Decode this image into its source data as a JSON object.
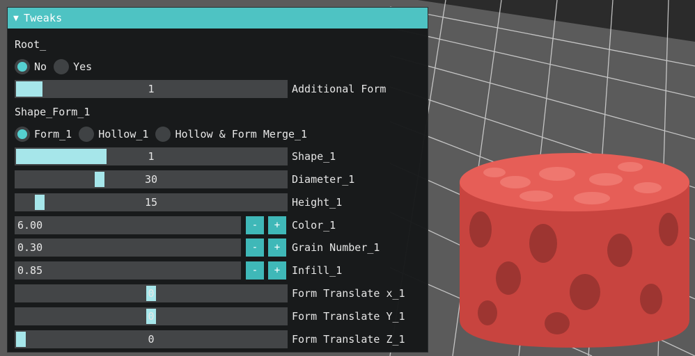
{
  "panel": {
    "title": "Tweaks",
    "collapse_arrow": "▼",
    "root_label": "Root_",
    "root_options": [
      {
        "label": "No",
        "selected": true
      },
      {
        "label": "Yes",
        "selected": false
      }
    ],
    "additional_form": {
      "value": "1",
      "label": "Additional Form",
      "level": 0.1
    },
    "shape_form_label": "Shape_Form_1",
    "shape_form_options": [
      {
        "label": "Form_1",
        "selected": true
      },
      {
        "label": "Hollow_1",
        "selected": false
      },
      {
        "label": "Hollow & Form Merge_1",
        "selected": false
      }
    ],
    "sliders": [
      {
        "value": "1",
        "label": "Shape_1",
        "level": 0.34,
        "fill": true
      },
      {
        "value": "30",
        "label": "Diameter_1",
        "level": 0.31,
        "fill": false
      },
      {
        "value": "15",
        "label": "Height_1",
        "level": 0.08,
        "fill": false
      }
    ],
    "steppers": [
      {
        "value": "6.00",
        "label": "Color_1",
        "minus": "-",
        "plus": "+"
      },
      {
        "value": "0.30",
        "label": "Grain Number_1",
        "minus": "-",
        "plus": "+"
      },
      {
        "value": "0.85",
        "label": "Infill_1",
        "minus": "-",
        "plus": "+"
      }
    ],
    "translates": [
      {
        "value": "0",
        "label": "Form Translate x_1",
        "level": 0.5
      },
      {
        "value": "0",
        "label": "Form Translate Y_1",
        "level": 0.5
      },
      {
        "value": "0",
        "label": "Form Translate Z_1",
        "level": 0.0
      }
    ]
  },
  "colors": {
    "accent": "#4ec3c3",
    "slider_grab": "#a6e6ea",
    "object": "#e65a52",
    "grid_bg": "#5a5a5a"
  }
}
